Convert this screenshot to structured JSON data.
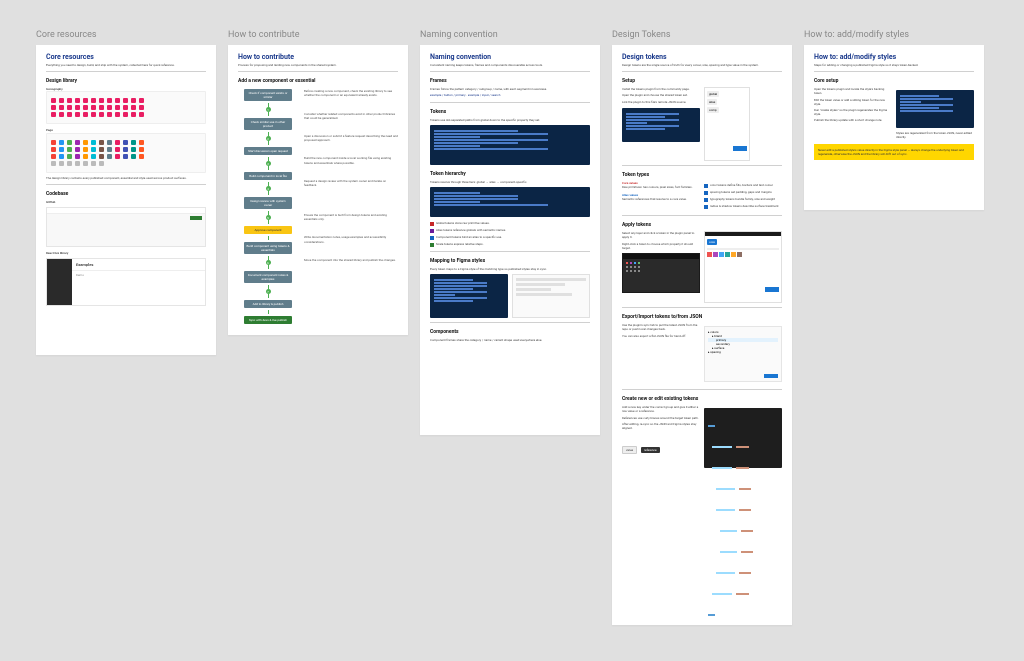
{
  "columns": {
    "core": {
      "label": "Core resources",
      "title": "Core resources",
      "sections": {
        "design_library": "Design library",
        "iconography": "Iconography",
        "page": "Page",
        "codebase": "Codebase",
        "github": "GitHub",
        "react_library": "React live library"
      }
    },
    "contribute": {
      "label": "How to contribute",
      "title": "How to contribute",
      "section": "Add a new component or essential",
      "steps": [
        "Check if component exists or similar",
        "Check similar use in other product",
        "Start discussion open request",
        "Build component in local file",
        "Design review with system owner",
        "Approve component",
        "Build component using tokens & essentials",
        "Document component notes & examples",
        "Add to library & publish",
        "Sync with devs & live publish"
      ],
      "notes": [
        "Before creating a new component, check the existing library to see whether the component or an equivalent already exists.",
        "Consider whether related components exist in other product libraries that could be generalized.",
        "Open a discussion or submit a feature request describing the need and proposed approach.",
        "Build the new component inside a local working file using existing tokens and essentials where possible.",
        "Request a design review with the system owner and iterate on feedback.",
        "Once approved, finalize the component structure and variants.",
        "Ensure the component is built from design tokens and existing essentials only.",
        "Write documentation notes, usage examples and accessibility considerations.",
        "Move the component into the shared library and publish the changes.",
        "Coordinate with engineering to publish the coded component and keep parity."
      ]
    },
    "naming": {
      "label": "Naming convention",
      "title": "Naming convention",
      "sections": {
        "frames": "Frames",
        "tokens": "Tokens",
        "hierarchy": "Token hierarchy",
        "mapping": "Mapping to Figma styles",
        "components": "Components"
      }
    },
    "tokens": {
      "label": "Design Tokens",
      "title": "Design tokens",
      "sections": {
        "setup": "Setup",
        "types": "Token types",
        "apply": "Apply tokens",
        "export": "Export/Import tokens to/from JSON",
        "create": "Create new or edit existing tokens"
      }
    },
    "styles": {
      "label": "How to: add/modify styles",
      "title": "How to: add/modify styles",
      "section": "Core setup"
    }
  }
}
